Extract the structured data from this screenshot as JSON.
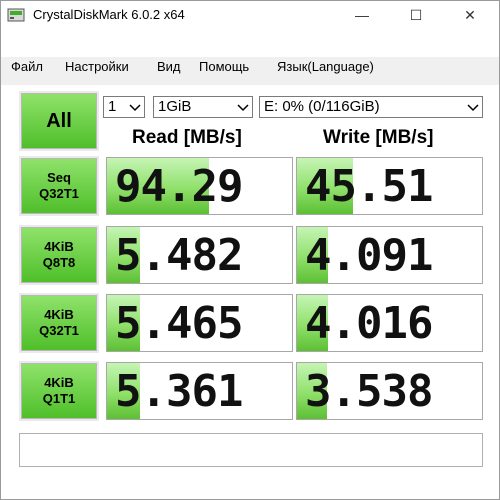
{
  "window": {
    "title": "CrystalDiskMark 6.0.2 x64",
    "minimize": "—",
    "maximize": "☐",
    "close": "✕"
  },
  "menu": [
    "Файл",
    "Настройки",
    "Вид",
    "Помощь",
    "Язык(Language)"
  ],
  "controls": {
    "all_label": "All",
    "runs": "1",
    "size": "1GiB",
    "drive": "E: 0% (0/116GiB)"
  },
  "headers": {
    "read": "Read [MB/s]",
    "write": "Write [MB/s]"
  },
  "tests": [
    {
      "line1": "Seq",
      "line2": "Q32T1",
      "read": "94.29",
      "write": "45.51",
      "read_fill": 0.55,
      "write_fill": 0.3
    },
    {
      "line1": "4KiB",
      "line2": "Q8T8",
      "read": "5.482",
      "write": "4.091",
      "read_fill": 0.18,
      "write_fill": 0.17
    },
    {
      "line1": "4KiB",
      "line2": "Q32T1",
      "read": "5.465",
      "write": "4.016",
      "read_fill": 0.18,
      "write_fill": 0.17
    },
    {
      "line1": "4KiB",
      "line2": "Q1T1",
      "read": "5.361",
      "write": "3.538",
      "read_fill": 0.18,
      "write_fill": 0.16
    }
  ],
  "status": "",
  "colors": {
    "accent_green": "#5dbf34"
  }
}
